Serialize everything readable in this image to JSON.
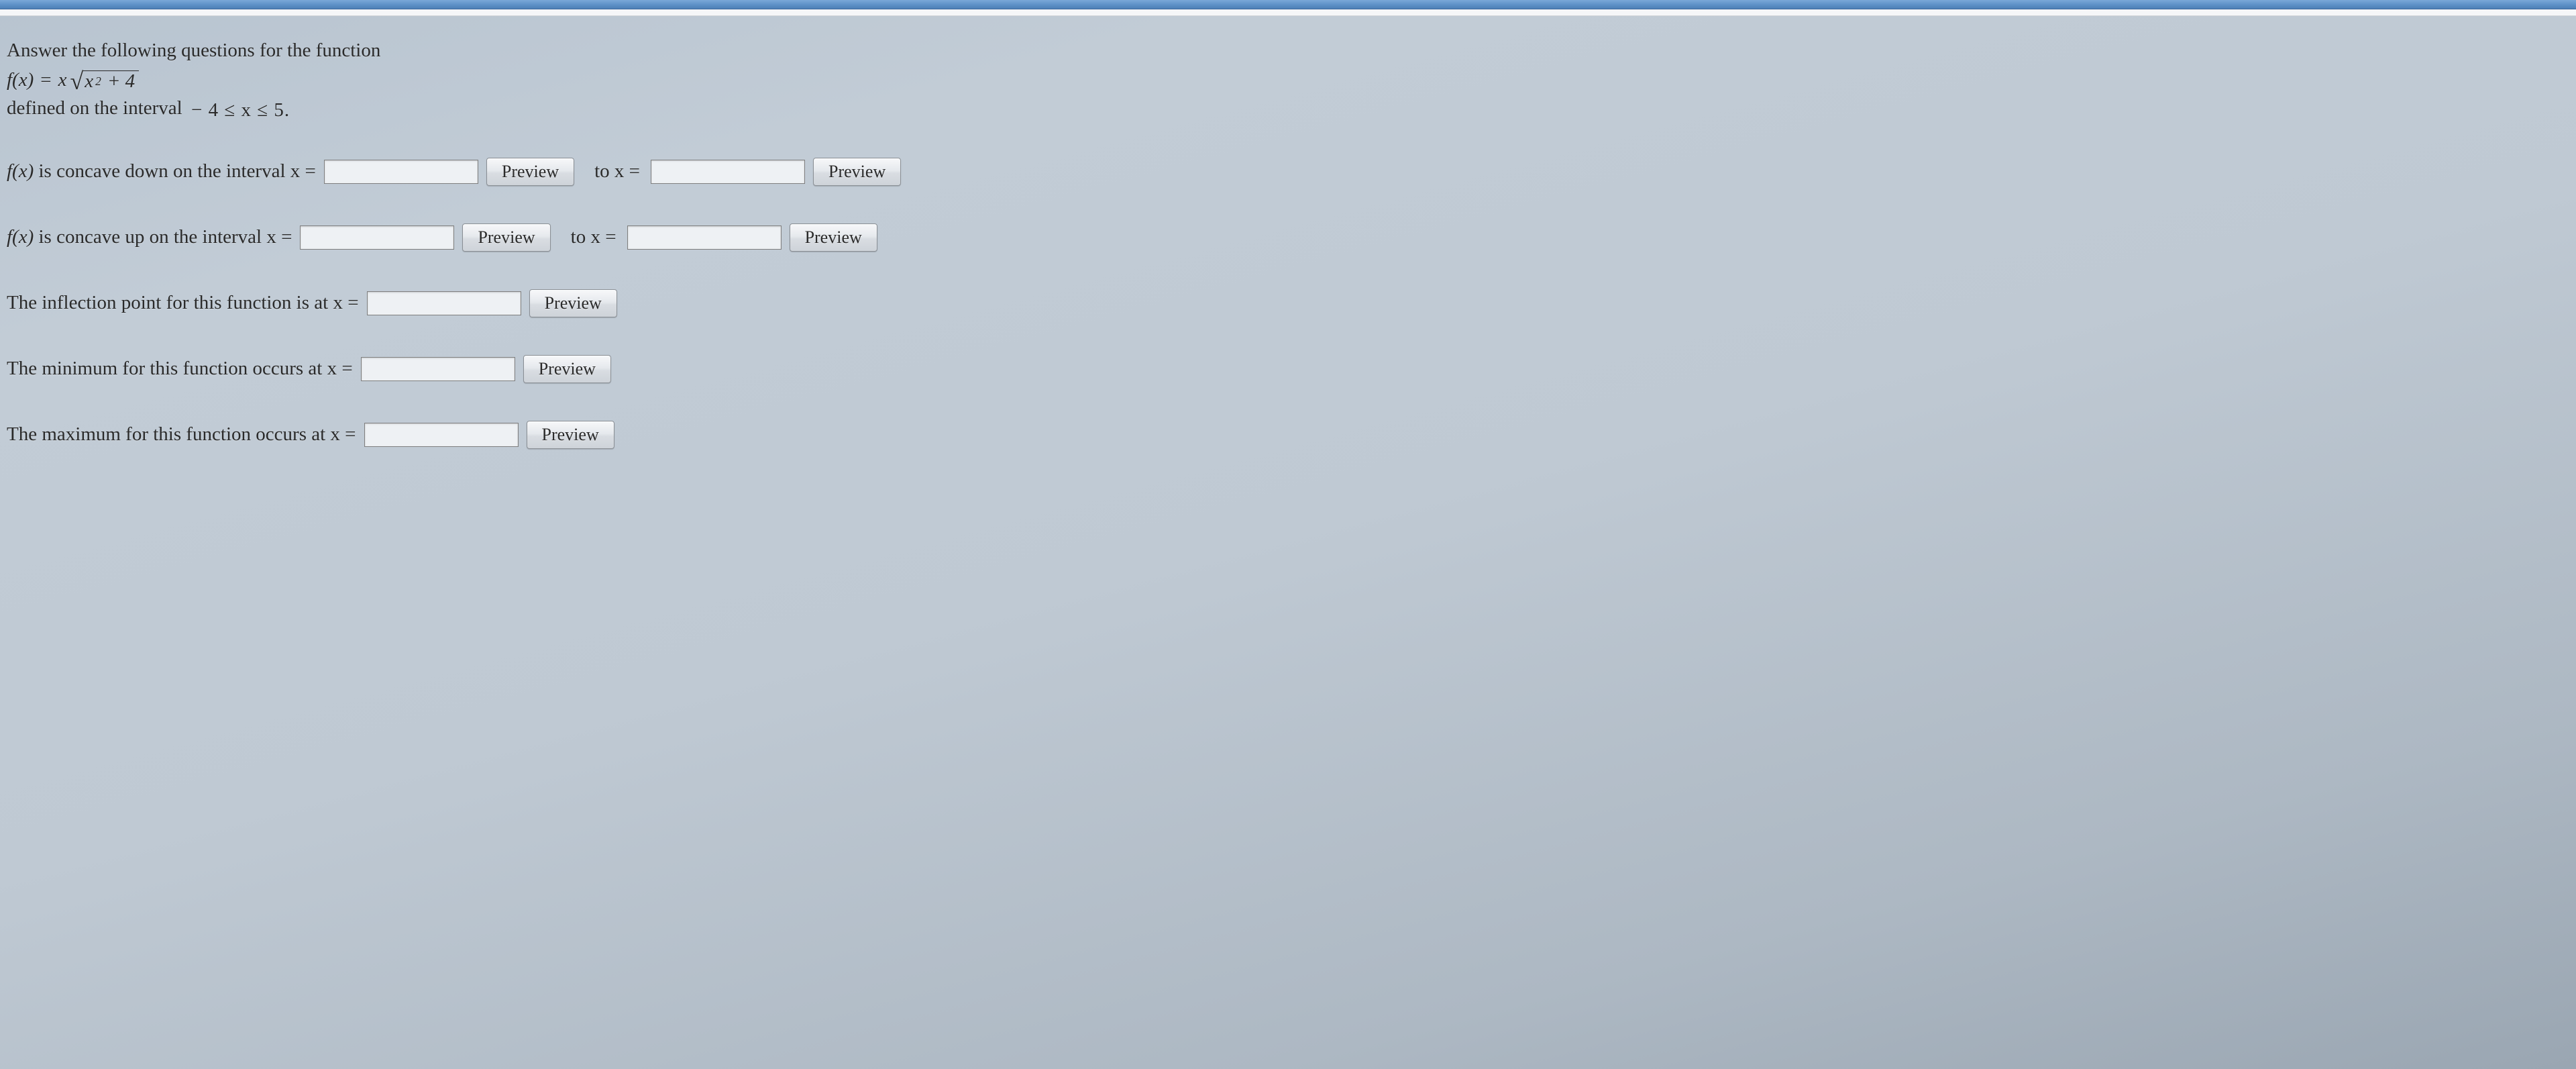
{
  "intro": {
    "line1": "Answer the following questions for the function",
    "formula_parts": {
      "fopen": "f(x)",
      "eq": "=",
      "coef": "x",
      "rad_inner_a": "x",
      "rad_inner_exp": "2",
      "rad_inner_plus": "+ 4"
    },
    "line3_a": "defined on the interval",
    "line3_interval": "− 4 ≤ x ≤ 5."
  },
  "rows": {
    "concave_down": {
      "lead": "f(x) ",
      "text": "is concave down on the interval x =",
      "tox": "to x ="
    },
    "concave_up": {
      "lead": "f(x) ",
      "text": "is concave up on the interval x =",
      "tox": "to x ="
    },
    "inflection": {
      "text": "The inflection point for this function is at x ="
    },
    "minimum": {
      "text": "The minimum for this function occurs at x ="
    },
    "maximum": {
      "text": "The maximum for this function occurs at x ="
    }
  },
  "buttons": {
    "preview": "Preview"
  }
}
